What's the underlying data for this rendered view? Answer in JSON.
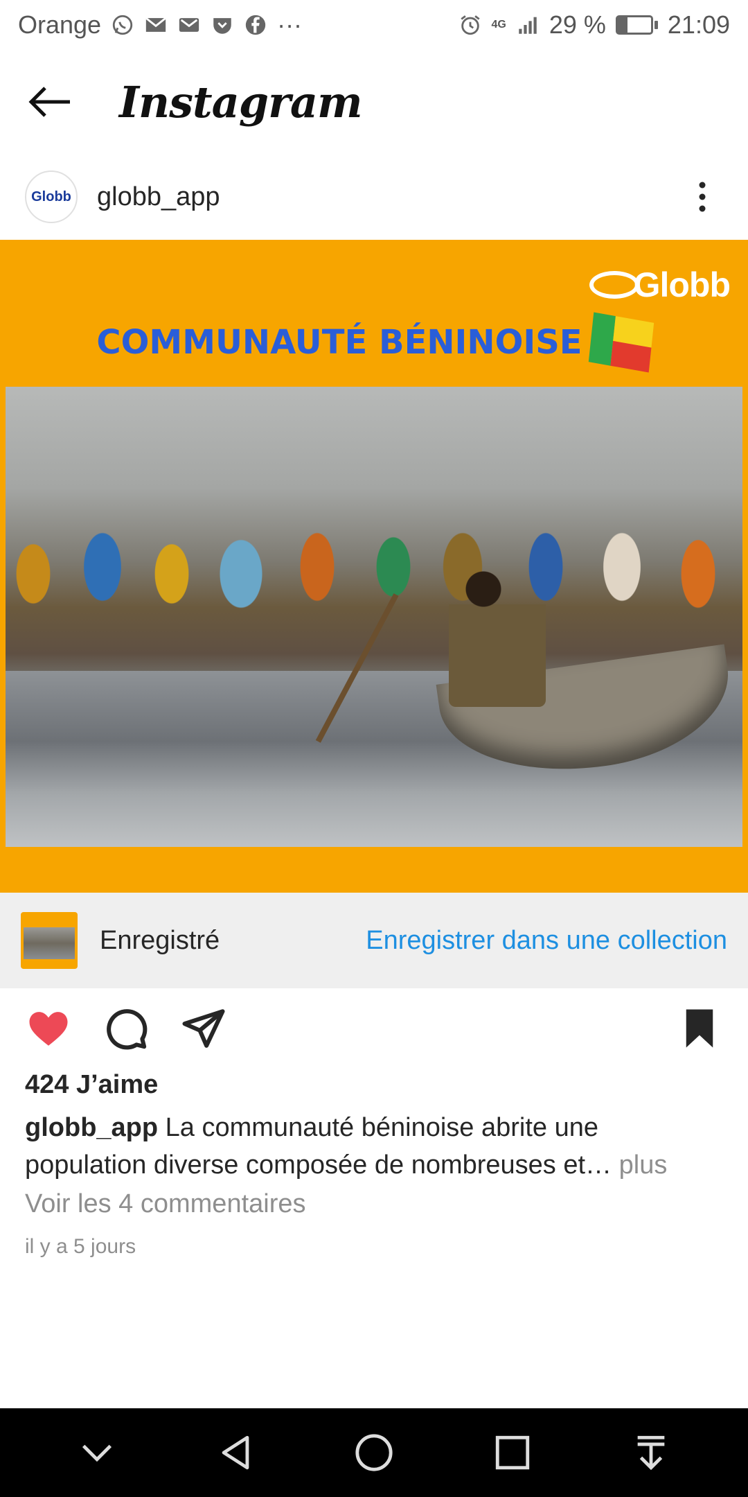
{
  "status_bar": {
    "carrier": "Orange",
    "notification_icons": [
      "whatsapp-icon",
      "mail-icon",
      "gmail-icon",
      "pocket-icon",
      "facebook-icon"
    ],
    "overflow": "···",
    "network": "4G",
    "battery_percent": "29 %",
    "battery_level": 0.29,
    "time": "21:09"
  },
  "app_bar": {
    "title": "Instagram",
    "back_icon": "back-arrow-icon"
  },
  "post": {
    "username": "globb_app",
    "avatar_text": "Globb",
    "image": {
      "brand": "Globb",
      "headline": "COMMUNAUTÉ BÉNINOISE",
      "background_color": "#f7a500",
      "headline_color": "#2a5ed8"
    },
    "saved_bar": {
      "label": "Enregistré",
      "action": "Enregistrer dans une collection"
    },
    "likes": "424 J’aime",
    "caption_user": "globb_app",
    "caption_text": " La communauté béninoise abrite une population diverse composée de nombreuses et…",
    "caption_more": " plus",
    "comments_link": "Voir les 4 commentaires",
    "timestamp": "il y a 5 jours",
    "liked": true,
    "saved": true
  },
  "colors": {
    "like_red": "#ed4956",
    "link_blue": "#1d8fe1",
    "muted": "#8e8e8e"
  },
  "nav_bar": {
    "buttons": [
      "chevron-down-icon",
      "back-triangle-icon",
      "home-circle-icon",
      "recents-square-icon",
      "notifications-pull-icon"
    ]
  }
}
